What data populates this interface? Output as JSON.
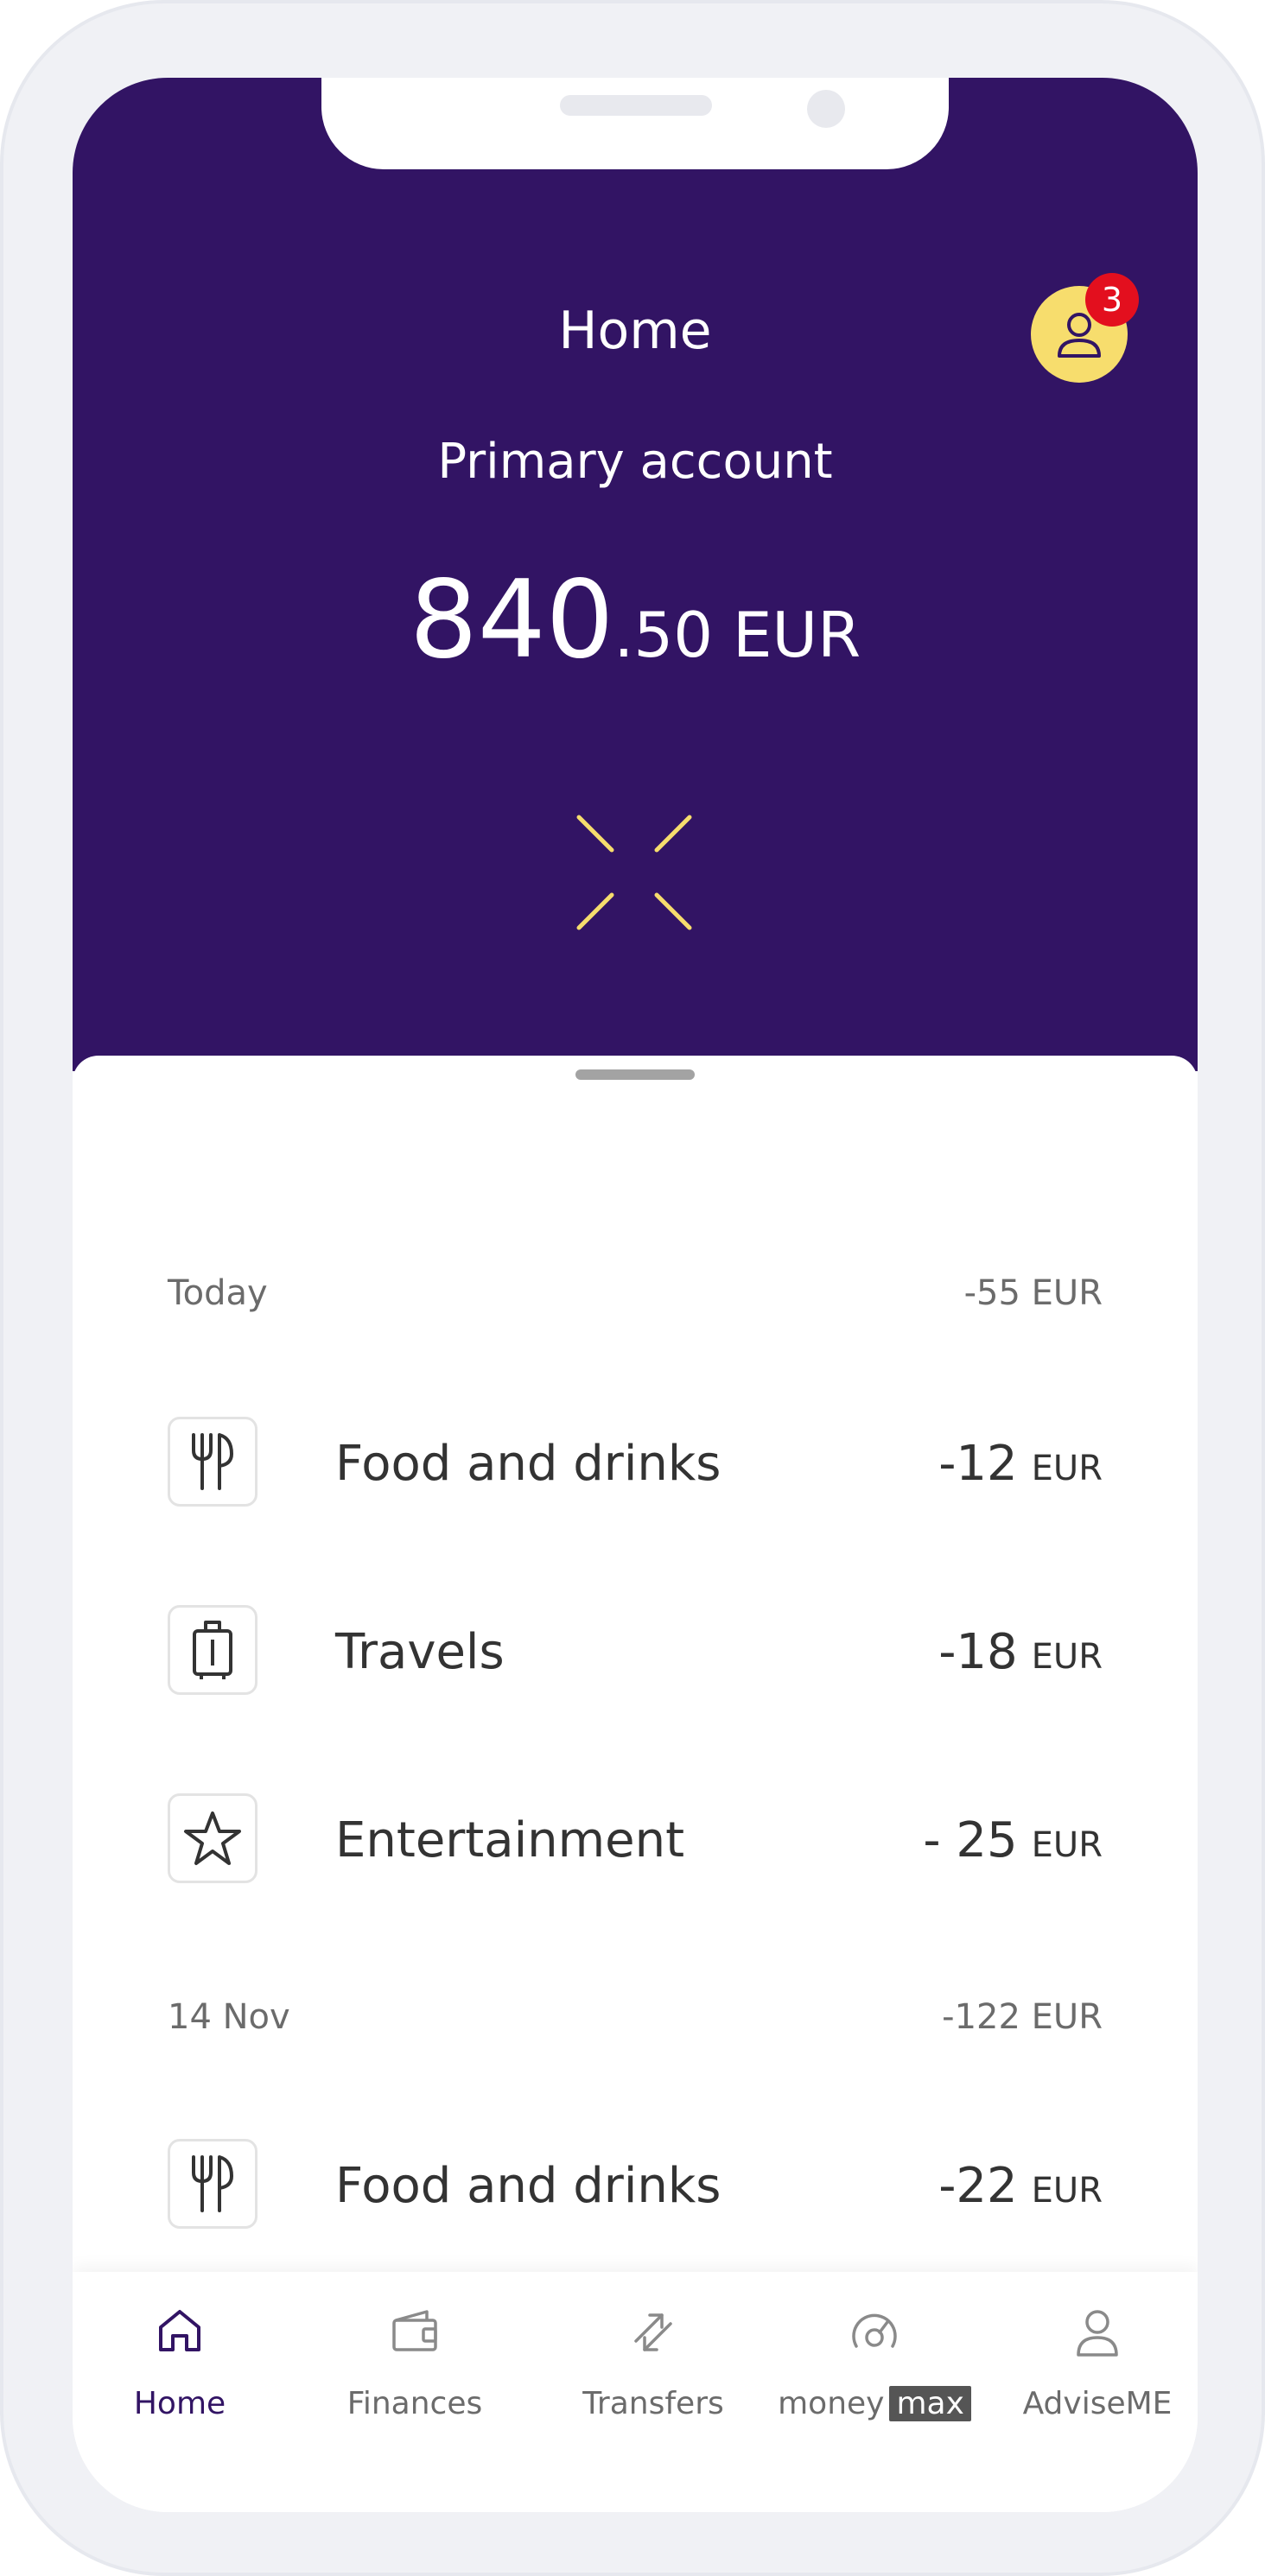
{
  "header": {
    "title": "Home",
    "account_name": "Primary account",
    "balance_whole": "840",
    "balance_fraction": ".50",
    "balance_currency": "EUR",
    "notifications_count": "3"
  },
  "groups": [
    {
      "date": "Today",
      "total": "-55 EUR",
      "transactions": [
        {
          "icon": "fork-knife-icon",
          "name": "Food and drinks",
          "amount": "-12",
          "currency": "EUR"
        },
        {
          "icon": "suitcase-icon",
          "name": "Travels",
          "amount": "-18",
          "currency": "EUR"
        },
        {
          "icon": "star-icon",
          "name": "Entertainment",
          "amount": "- 25",
          "currency": "EUR"
        }
      ]
    },
    {
      "date": "14 Nov",
      "total": "-122 EUR",
      "transactions": [
        {
          "icon": "fork-knife-icon",
          "name": "Food and drinks",
          "amount": "-22",
          "currency": "EUR"
        }
      ]
    }
  ],
  "tabs": [
    {
      "label": "Home",
      "icon": "home-icon",
      "active": true
    },
    {
      "label": "Finances",
      "icon": "wallet-icon",
      "active": false
    },
    {
      "label": "Transfers",
      "icon": "transfer-arrows-icon",
      "active": false
    },
    {
      "label_prefix": "money",
      "label_box": "max",
      "icon": "gauge-icon",
      "active": false
    },
    {
      "label": "AdviseME",
      "icon": "advisor-icon",
      "active": false
    }
  ],
  "colors": {
    "brand_purple": "#321464",
    "accent_yellow": "#f7dd6d",
    "badge_red": "#e30f1e"
  }
}
